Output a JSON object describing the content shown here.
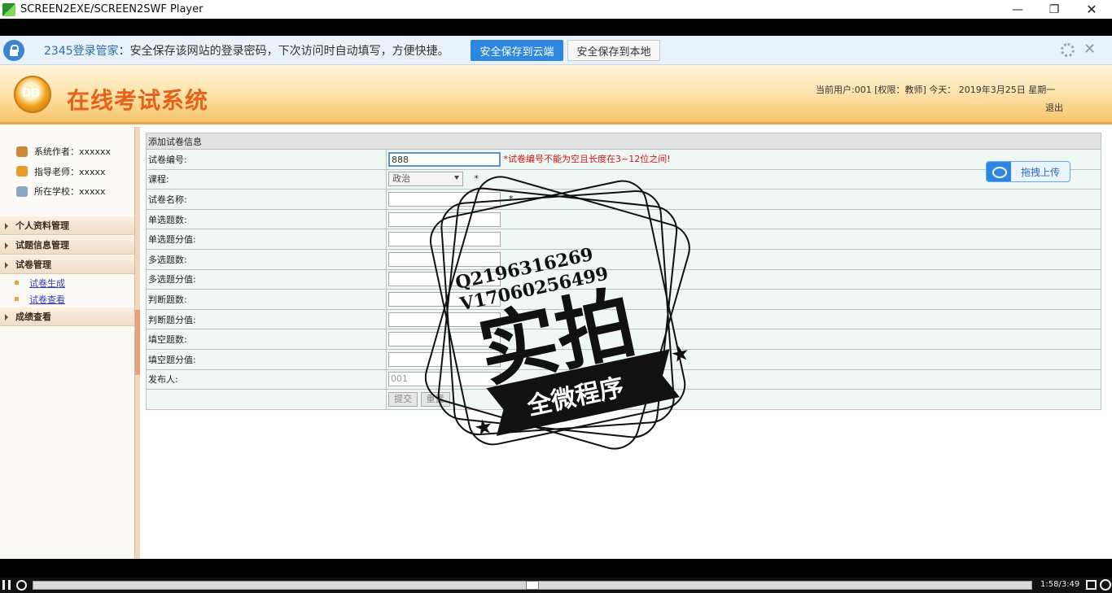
{
  "window": {
    "title": "SCREEN2EXE/SCREEN2SWF Player"
  },
  "password_bar": {
    "brand": "2345登录管家",
    "message": "：安全保存该网站的登录密码，下次访问时自动填写，方便快捷。",
    "save_cloud": "安全保存到云端",
    "save_local": "安全保存到本地"
  },
  "header": {
    "system_title": "在线考试系统",
    "user_info": "当前用户:001 [权限：教师] 今天： 2019年3月25日   星期一",
    "logout": "退出"
  },
  "sidebar": {
    "info": [
      {
        "label": "系统作者：xxxxxx"
      },
      {
        "label": "指导老师：xxxxx"
      },
      {
        "label": "所在学校：xxxxx"
      }
    ],
    "menu": {
      "personal": "个人资料管理",
      "questions": "试题信息管理",
      "papers": "试卷管理",
      "paper_generate": "试卷生成",
      "paper_view": "试卷查看",
      "scores": "成绩查看"
    }
  },
  "form": {
    "caption": "添加试卷信息",
    "upload_label": "拖拽上传",
    "paper_id_label": "试卷编号:",
    "paper_id_value": "888",
    "paper_id_error": "*试卷编号不能为空且长度在3~12位之间!",
    "course_label": "课程:",
    "course_value": "政治",
    "required_mark": "*",
    "paper_name_label": "试卷名称:",
    "single_count_label": "单选题数:",
    "single_score_label": "单选题分值:",
    "multi_count_label": "多选题数:",
    "multi_score_label": "多选题分值:",
    "judge_count_label": "判断题数:",
    "judge_score_label": "判断题分值:",
    "fill_count_label": "填空题数:",
    "fill_score_label": "填空题分值:",
    "publisher_label": "发布人:",
    "publisher_value": "001",
    "submit": "提交",
    "reset": "重置"
  },
  "watermark": {
    "line1": "Q2196316269",
    "line2": "V17060256499",
    "big": "实拍",
    "ribbon": "全微程序"
  },
  "player": {
    "time": "1:58/3:49",
    "progress": 0.5
  }
}
